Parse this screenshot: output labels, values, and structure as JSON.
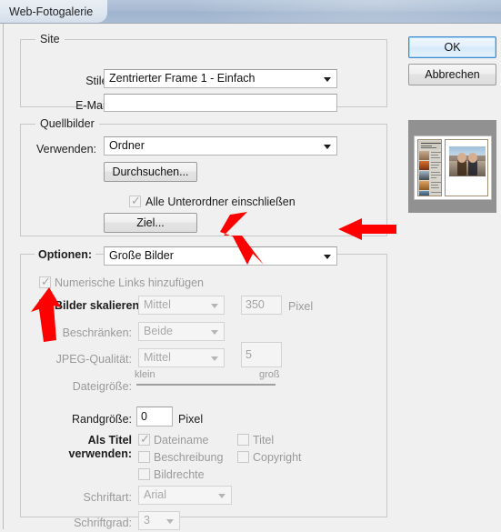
{
  "window": {
    "title": "Web-Fotogalerie"
  },
  "buttons": {
    "ok": "OK",
    "cancel": "Abbrechen"
  },
  "groups": {
    "site": "Site",
    "source_images": "Quellbilder",
    "options": "Optionen:"
  },
  "site": {
    "style_label": "Stile:",
    "style_value": "Zentrierter Frame 1 - Einfach",
    "email_label": "E-Mail:",
    "email_value": "",
    "email_placeholder": ""
  },
  "source": {
    "use_label": "Verwenden:",
    "use_value": "Ordner",
    "browse_button": "Durchsuchen...",
    "include_subfolders_label": "Alle Unterordner einschließen",
    "include_subfolders_checked": true,
    "destination_button": "Ziel..."
  },
  "options": {
    "options_value": "Große Bilder",
    "numeric_links_label": "Numerische Links hinzufügen",
    "numeric_links_checked": true,
    "resize_label": "Bilder skalieren:",
    "resize_checked": false,
    "resize_size_value": "Mittel",
    "resize_pixel_value": "350",
    "resize_pixel_unit": "Pixel",
    "constrain_label": "Beschränken:",
    "constrain_value": "Beide",
    "jpeg_quality_label": "JPEG-Qualität:",
    "jpeg_quality_value": "Mittel",
    "jpeg_quality_number": "5",
    "filesize_label": "Dateigröße:",
    "filesize_min": "klein",
    "filesize_max": "groß",
    "border_label": "Randgröße:",
    "border_value": "0",
    "border_unit": "Pixel",
    "title_use_label_line1": "Als Titel",
    "title_use_label_line2": "verwenden:",
    "cb_filename": "Dateiname",
    "cb_filename_checked": true,
    "cb_title": "Titel",
    "cb_title_checked": false,
    "cb_description": "Beschreibung",
    "cb_description_checked": false,
    "cb_copyright": "Copyright",
    "cb_copyright_checked": false,
    "cb_imagerights": "Bildrechte",
    "cb_imagerights_checked": false,
    "font_label": "Schriftart:",
    "font_value": "Arial",
    "fontsize_label": "Schriftgrad:",
    "fontsize_value": "3"
  },
  "annotations": {
    "color": "#ff0000",
    "arrow_1": "arrow-pointing-to-options-dropdown",
    "arrow_2": "arrow-pointing-left-at-options-row",
    "arrow_3": "arrow-pointing-up-at-resize-checkbox"
  },
  "preview": {
    "caption": "web-photo-gallery-preview"
  }
}
